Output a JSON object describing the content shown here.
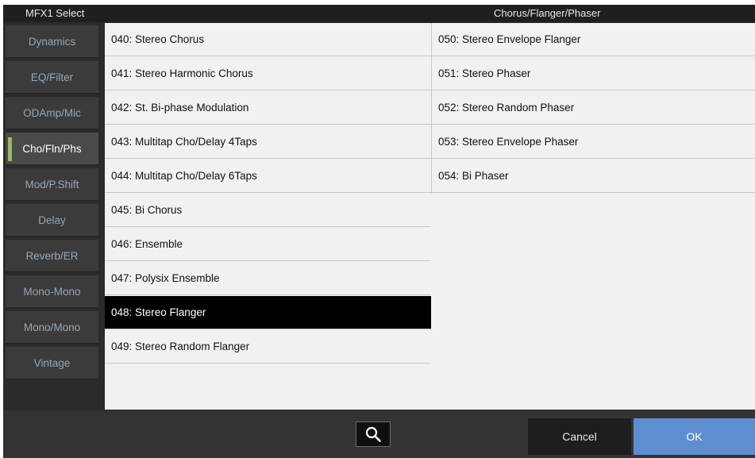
{
  "header": {
    "left_title": "MFX1 Select",
    "right_title": "Chorus/Flanger/Phaser"
  },
  "sidebar": {
    "categories": [
      {
        "label": "Dynamics",
        "selected": false
      },
      {
        "label": "EQ/Filter",
        "selected": false
      },
      {
        "label": "ODAmp/Mic",
        "selected": false
      },
      {
        "label": "Cho/Fln/Phs",
        "selected": true
      },
      {
        "label": "Mod/P.Shift",
        "selected": false
      },
      {
        "label": "Delay",
        "selected": false
      },
      {
        "label": "Reverb/ER",
        "selected": false
      },
      {
        "label": "Mono-Mono",
        "selected": false
      },
      {
        "label": "Mono/Mono",
        "selected": false
      },
      {
        "label": "Vintage",
        "selected": false
      }
    ]
  },
  "effects": {
    "left_column": [
      {
        "label": "040: Stereo Chorus",
        "selected": false
      },
      {
        "label": "041: Stereo Harmonic Chorus",
        "selected": false
      },
      {
        "label": "042: St. Bi-phase Modulation",
        "selected": false
      },
      {
        "label": "043: Multitap Cho/Delay 4Taps",
        "selected": false
      },
      {
        "label": "044: Multitap Cho/Delay 6Taps",
        "selected": false
      },
      {
        "label": "045: Bi Chorus",
        "selected": false
      },
      {
        "label": "046: Ensemble",
        "selected": false
      },
      {
        "label": "047: Polysix Ensemble",
        "selected": false
      },
      {
        "label": "048: Stereo Flanger",
        "selected": true
      },
      {
        "label": "049: Stereo Random Flanger",
        "selected": false
      }
    ],
    "right_column": [
      {
        "label": "050: Stereo Envelope Flanger",
        "selected": false
      },
      {
        "label": "051: Stereo Phaser",
        "selected": false
      },
      {
        "label": "052: Stereo Random Phaser",
        "selected": false
      },
      {
        "label": "053: Stereo Envelope Phaser",
        "selected": false
      },
      {
        "label": "054: Bi Phaser",
        "selected": false
      }
    ]
  },
  "footer": {
    "search_icon": "search-icon",
    "cancel_label": "Cancel",
    "ok_label": "OK"
  },
  "colors": {
    "accent_ok": "#5f8ed0",
    "selected_indicator": "#9cb66a",
    "selected_item_bg": "#000000"
  }
}
